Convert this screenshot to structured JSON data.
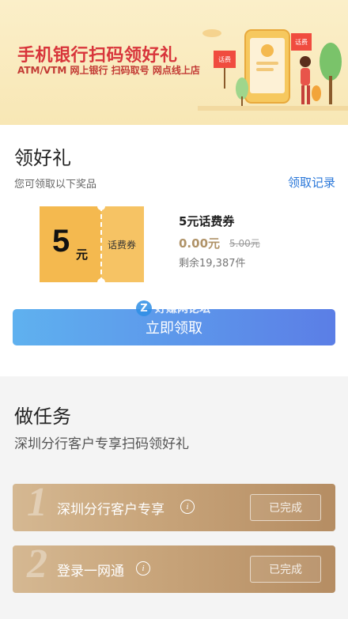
{
  "banner": {
    "title": "手机银行扫码领好礼",
    "subtitle": "ATM/VTM  网上银行  扫码取号  网点线上店",
    "sign_left": "话费",
    "sign_right": "话费"
  },
  "gifts": {
    "title": "领好礼",
    "subtitle": "您可领取以下奖品",
    "record_link": "领取记录",
    "coupon": {
      "amount": "5",
      "unit": "元",
      "type": "话费券"
    },
    "prize": {
      "name": "5元话费券",
      "price": "0.00元",
      "original_price": "5.00元",
      "stock": "剩余19,387件"
    },
    "watermark": "好赚网论坛",
    "claim_button": "立即领取"
  },
  "tasks": {
    "title": "做任务",
    "subtitle": "深圳分行客户专享扫码领好礼",
    "items": [
      {
        "number": "1",
        "label": "深圳分行客户专享",
        "status": "已完成"
      },
      {
        "number": "2",
        "label": "登录一网通",
        "status": "已完成"
      }
    ]
  },
  "colors": {
    "accent_blue": "#2b78d9",
    "coupon_gold": "#f4b94f",
    "task_gold": "#c9a67c",
    "banner_red": "#d8353b"
  }
}
